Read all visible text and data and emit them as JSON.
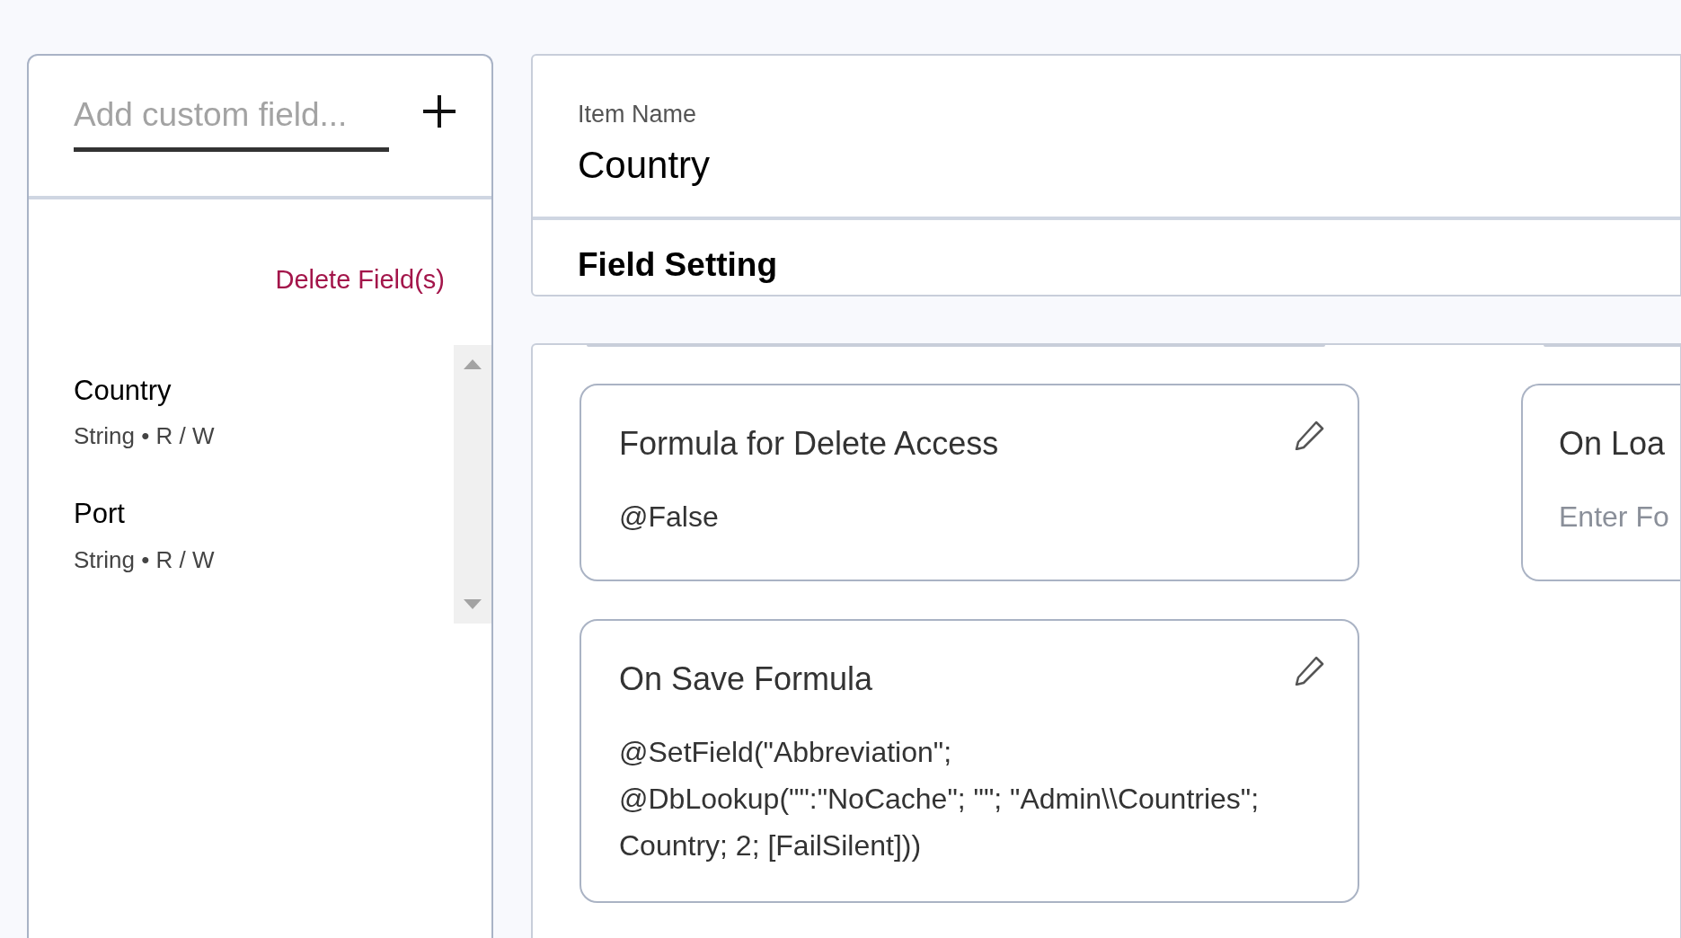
{
  "sidebar": {
    "add_field": {
      "placeholder": "Add custom field..."
    },
    "delete_link": "Delete Field(s)",
    "fields": [
      {
        "name": "Country",
        "detail": "String • R / W"
      },
      {
        "name": "Port",
        "detail": "String • R / W"
      }
    ]
  },
  "header": {
    "label": "Item Name",
    "value": "Country",
    "section_title": "Field Setting"
  },
  "formula_cards": [
    {
      "title": "Formula for Delete Access",
      "value": "@False"
    },
    {
      "title": "On Loa",
      "placeholder": "Enter Fo"
    },
    {
      "title": "On Save Formula",
      "value": "@SetField(\"Abbreviation\"; @DbLookup(\"\":\"NoCache\"; \"\"; \"Admin\\\\Countries\"; Country; 2; [FailSilent]))"
    }
  ]
}
